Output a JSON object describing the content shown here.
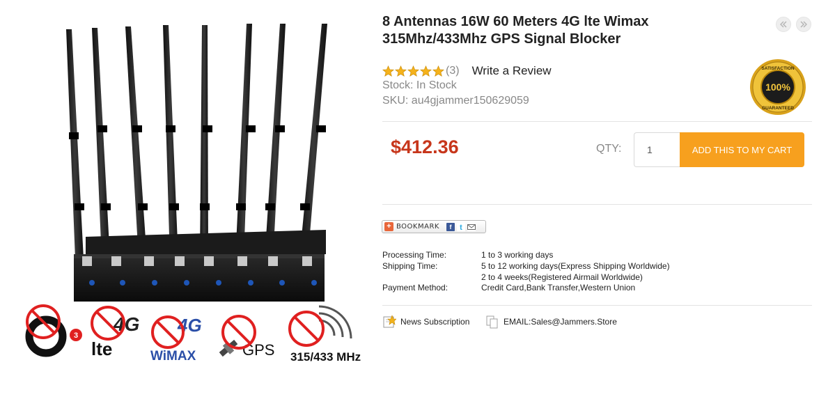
{
  "product": {
    "title_line1": "8 Antennas 16W 60 Meters 4G lte Wimax",
    "title_line2": "315Mhz/433Mhz GPS Signal Blocker",
    "rating": 5,
    "review_count": "(3)",
    "write_review": "Write a Review",
    "stock": "Stock: In Stock",
    "sku": "SKU: au4gjammer150629059",
    "price": "$412.36"
  },
  "image_badges": {
    "band1_number": "3",
    "band2_text": "lte",
    "band2_g": "4G",
    "band3_g": "4G",
    "band3_text": "WiMAX",
    "band4_text": "GPS",
    "band5_text": "315/433 MHz"
  },
  "guarantee_badge": {
    "top_text": "SATISFACTION",
    "center_text": "100%",
    "bottom_text": "GUARANTEED"
  },
  "cart": {
    "qty_label": "QTY:",
    "qty_value": "1",
    "add_button": "ADD THIS TO MY CART"
  },
  "bookmark": {
    "label": "BOOKMARK",
    "plus": "+",
    "facebook": "f",
    "twitter": "t"
  },
  "info": {
    "processing_label": "Processing Time:",
    "processing_value": "1 to 3 working days",
    "shipping_label": "Shipping Time:",
    "shipping_value1": "5 to 12 working days(Express Shipping Worldwide)",
    "shipping_value2": "2 to 4 weeks(Registered Airmail Worldwide)",
    "payment_label": "Payment Method:",
    "payment_value": "Credit Card,Bank Transfer,Western Union"
  },
  "footer": {
    "news_subscription": "News Subscription",
    "email": "EMAIL:Sales@Jammers.Store"
  },
  "colors": {
    "price": "#c7361b",
    "cart_button": "#f7a01e",
    "star": "#f5b21b",
    "prohibited": "#e02020"
  }
}
